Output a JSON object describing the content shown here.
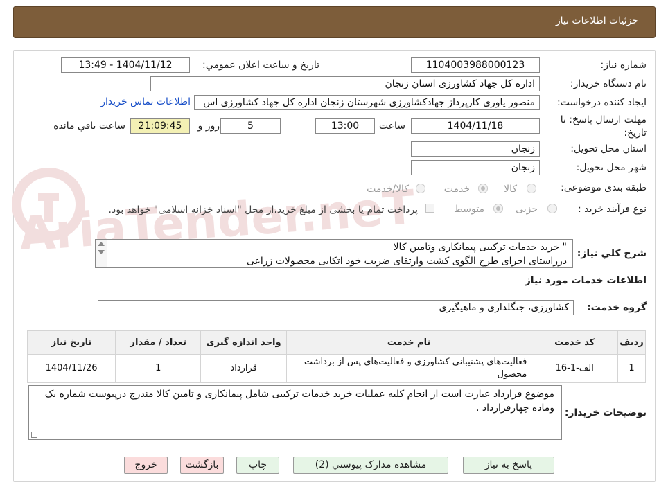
{
  "header": {
    "title": "جزئیات اطلاعات نیاز"
  },
  "watermark": {
    "text": "AriaTender.neT"
  },
  "need_number": {
    "label": "شماره نیاز:",
    "value": "1104003988000123"
  },
  "announce": {
    "label": "تاریخ و ساعت اعلان عمومي:",
    "value": "1404/11/12 - 13:49"
  },
  "buyer": {
    "label": "نام دستگاه خريدار:",
    "value": "اداره کل جهاد کشاورزی استان زنجان"
  },
  "requester": {
    "label": "ايجاد کننده درخواست:",
    "value": "منصور یاوری کارپرداز جهادکشاورزی شهرستان زنجان اداره کل جهاد کشاورزی اس",
    "contact_link": "اطلاعات تماس خریدار"
  },
  "deadline": {
    "label_line1": "مهلت ارسال پاسخ: تا",
    "label_line2": "تاريخ:",
    "date": "1404/11/18",
    "time_label": "ساعت",
    "time": "13:00",
    "days": "5",
    "days_label": "روز و",
    "remaining": "21:09:45",
    "remaining_label": "ساعت باقي مانده"
  },
  "delivery_province": {
    "label": "استان محل تحويل:",
    "value": "زنجان"
  },
  "delivery_city": {
    "label": "شهر محل تحويل:",
    "value": "زنجان"
  },
  "category": {
    "label": "طبقه بندی موضوعی:",
    "options": [
      "کالا",
      "خدمت",
      "کالا/خدمت"
    ],
    "selected": "خدمت"
  },
  "purchase_type": {
    "label": "نوع فرآیند خرید :",
    "options": [
      "جزیی",
      "متوسط"
    ],
    "selected": "متوسط",
    "payment_note": "پرداخت تمام یا بخشی از مبلغ خرید،از محل \"اسناد خزانه اسلامی\" خواهد بود."
  },
  "description": {
    "label": "شرح کلي نياز:",
    "line1": "\" خرید خدمات ترکیبی پیمانکاری وتامین کالا",
    "line2": "درراستای اجرای طرح الگوی کشت وارتقای ضریب خود اتکایی محصولات زراعی"
  },
  "services_section": {
    "title": "اطلاعات خدمات مورد نياز"
  },
  "service_group": {
    "label": "گروه خدمت:",
    "value": "کشاورزی، جنگلداری و ماهیگیری"
  },
  "table": {
    "headers": [
      "رديف",
      "کد خدمت",
      "نام خدمت",
      "واحد اندازه گیری",
      "تعداد / مقدار",
      "تاریخ نیاز"
    ],
    "rows": [
      {
        "index": "1",
        "code": "الف-1-16",
        "name": "فعالیت‌های پشتیبانی کشاورزی و فعالیت‌های پس از برداشت محصول",
        "unit": "قرارداد",
        "qty": "1",
        "date": "1404/11/26"
      }
    ]
  },
  "buyer_notes": {
    "label": "توضيحات خريدار:",
    "text": "موضوع قرارداد عبارت است از انجام کلیه عملیات خرید خدمات ترکیبی شامل پیمانکاری و تامین کالا مندرج درپیوست شماره یک وماده چهارقرارداد ."
  },
  "buttons": {
    "respond": "پاسخ به نياز",
    "attachments": "مشاهده مدارک پيوستي (2)",
    "print": "چاپ",
    "back": "بازگشت",
    "exit": "خروج"
  },
  "colors": {
    "header_bg": "#7d5d3a",
    "link": "#1a50c8",
    "remaining_bg": "#f3f0b4",
    "back_btn": "#fbdcdc",
    "action_btn": "#e6f5e6"
  }
}
